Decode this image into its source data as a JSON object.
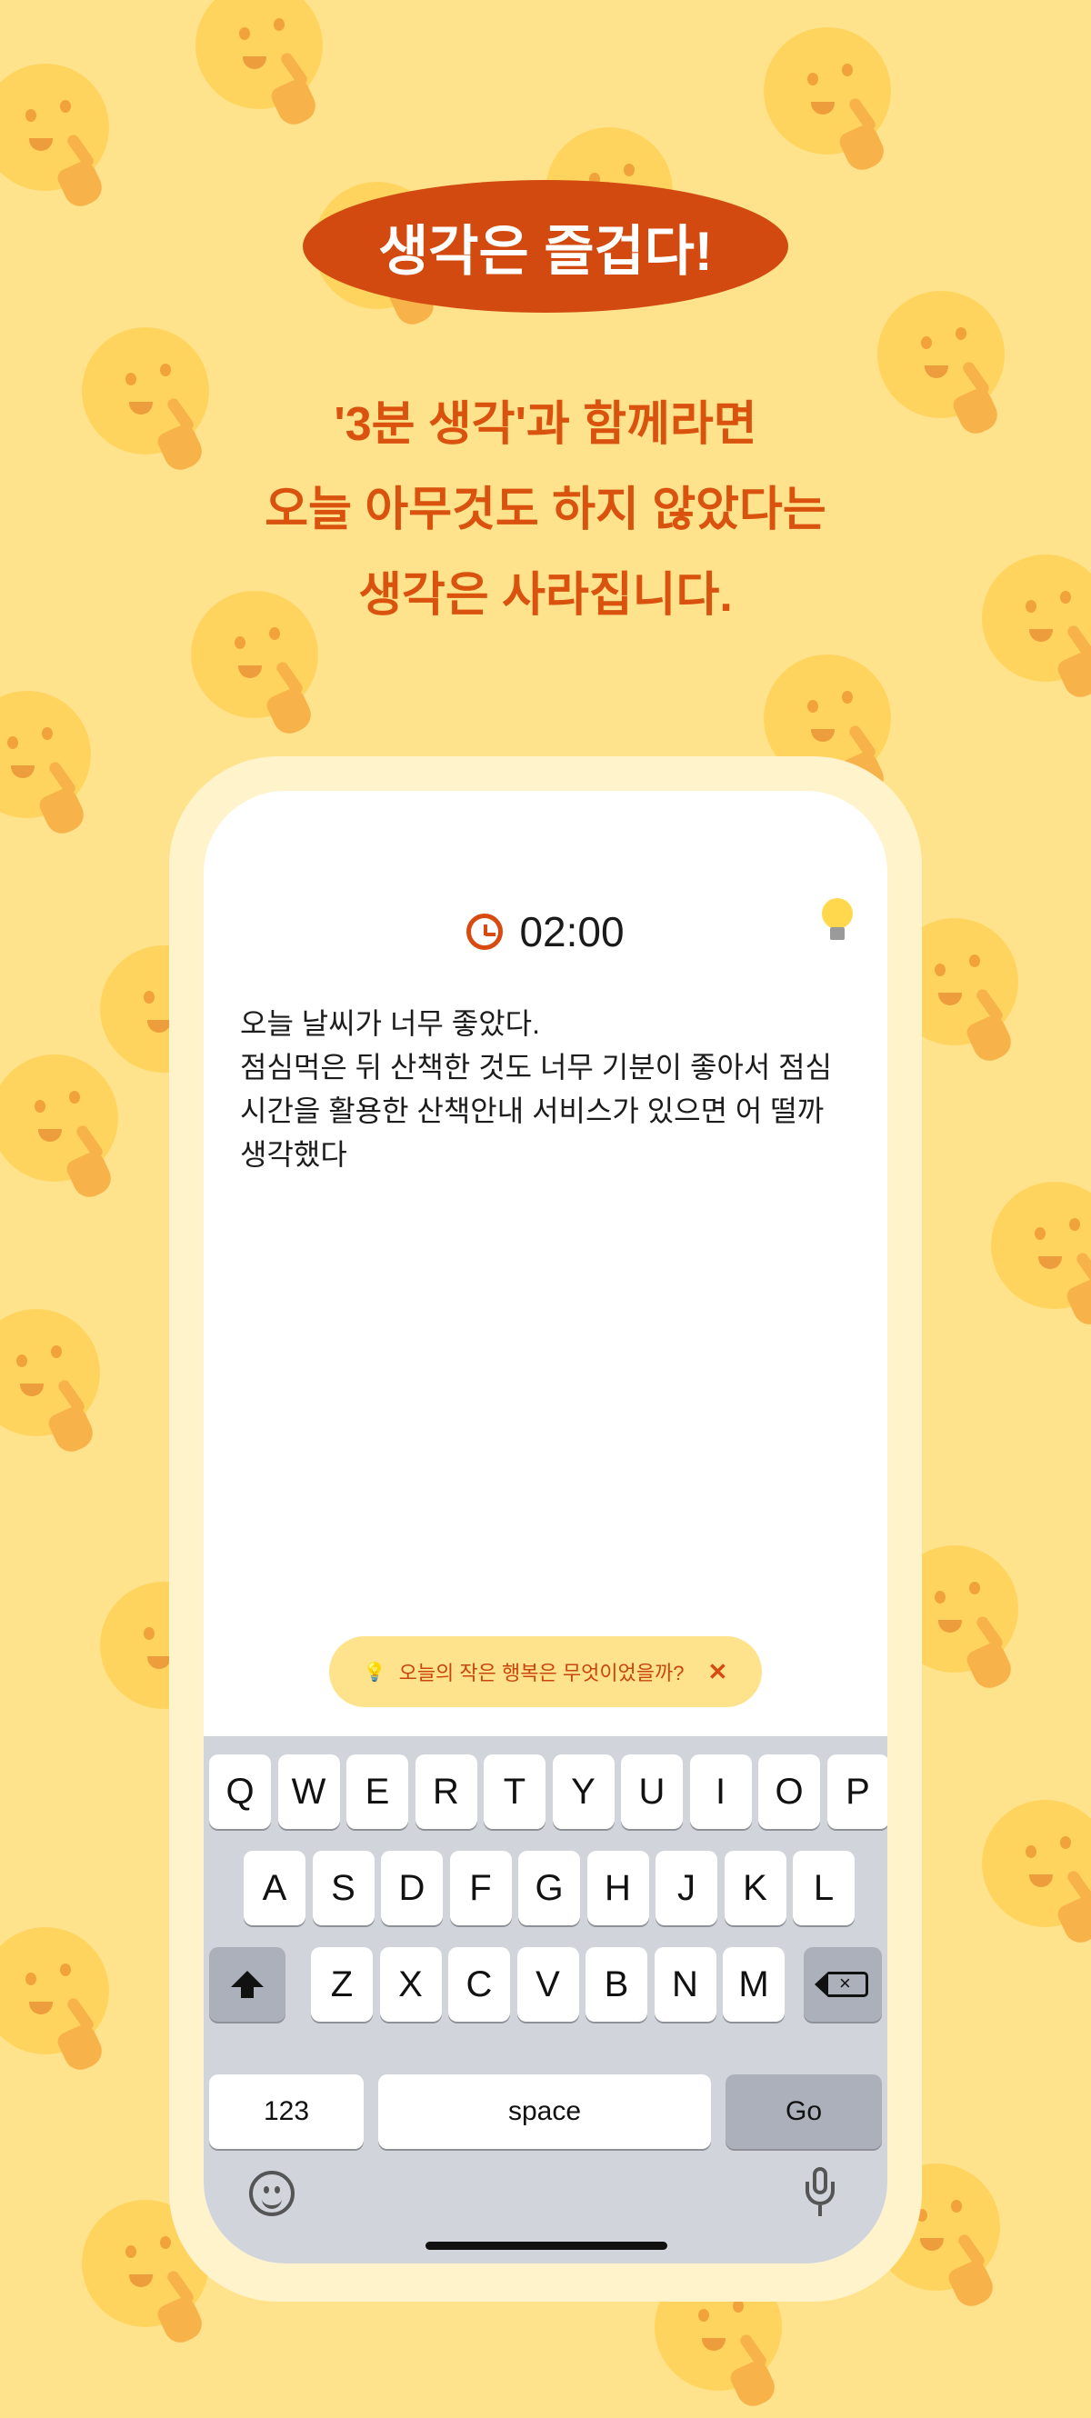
{
  "headline": "생각은 즐겁다!",
  "subtitle": {
    "line1": "'3분 생각'과 함께라면",
    "line2": "오늘 아무것도 하지 않았다는",
    "line3": "생각은 사라집니다."
  },
  "app": {
    "timer": "02:00",
    "note": "오늘 날씨가 너무 좋았다.\n점심먹은 뒤 산책한 것도 너무 기분이 좋아서 점심\n시간을 활용한 산책안내 서비스가 있으면 어 떨까\n생각했다",
    "prompt_chip": {
      "text": "오늘의 작은 행복은 무엇이었을까?",
      "close": "✕"
    }
  },
  "keyboard": {
    "row1": [
      "Q",
      "W",
      "E",
      "R",
      "T",
      "Y",
      "U",
      "I",
      "O",
      "P"
    ],
    "row2": [
      "A",
      "S",
      "D",
      "F",
      "G",
      "H",
      "J",
      "K",
      "L"
    ],
    "row3": [
      "Z",
      "X",
      "C",
      "V",
      "B",
      "N",
      "M"
    ],
    "numbers_label": "123",
    "space_label": "space",
    "go_label": "Go"
  },
  "colors": {
    "background": "#ffe38c",
    "accent": "#d24a0f",
    "subtitle_text": "#d9530f",
    "keyboard_bg": "#d1d4db"
  },
  "icons": [
    "clock-icon",
    "lightbulb-icon",
    "shift-icon",
    "backspace-icon",
    "emoji-icon",
    "microphone-icon"
  ]
}
